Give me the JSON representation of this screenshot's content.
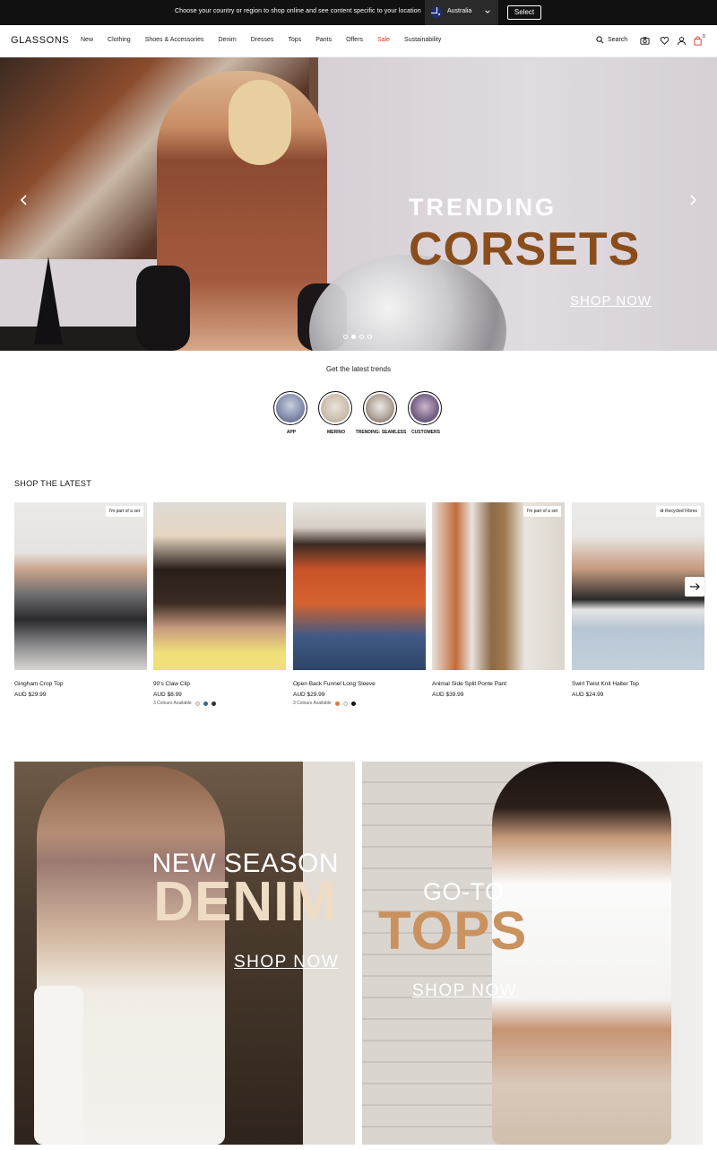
{
  "region_bar": {
    "message": "Choose your country or region to shop online and see content specific to your location",
    "country": "Australia",
    "select_label": "Select"
  },
  "header": {
    "logo": "GLASSONS",
    "nav": [
      "New",
      "Clothing",
      "Shoes & Accessories",
      "Denim",
      "Dresses",
      "Tops",
      "Pants",
      "Offers",
      "Sale",
      "Sustainability"
    ],
    "search_label": "Search",
    "cart_count": "0",
    "sale_color": "#d8342c"
  },
  "hero": {
    "line1": "TRENDING",
    "line2": "CORSETS",
    "cta": "SHOP NOW",
    "accent_color": "#8a4e1d",
    "slide_count": 4,
    "active_slide": 2
  },
  "trends": {
    "title": "Get the latest trends",
    "items": [
      {
        "label": "APP"
      },
      {
        "label": "MERINO"
      },
      {
        "label": "TRENDING: SEAMLESS"
      },
      {
        "label": "CUSTOMERS"
      }
    ]
  },
  "latest": {
    "title": "SHOP THE LATEST",
    "products": [
      {
        "name": "Gingham Crop Top",
        "price": "AUD $29.99",
        "tag": "I'm part of a set",
        "colours": "",
        "swatches": []
      },
      {
        "name": "90's Claw Clip",
        "price": "AUD $8.99",
        "tag": "",
        "colours": "3 Colours Available",
        "swatches": [
          "#e8e4dd",
          "#2f6a8e",
          "#3b2e2b"
        ]
      },
      {
        "name": "Open Back Funnel Long Sleeve",
        "price": "AUD $29.99",
        "tag": "",
        "colours": "3 Colours Available",
        "swatches": [
          "#e07a3a",
          "#f2efe9",
          "#111111"
        ]
      },
      {
        "name": "Animal Side Split Ponte Pant",
        "price": "AUD $39.99",
        "tag": "I'm part of a set",
        "colours": "",
        "swatches": []
      },
      {
        "name": "Swirl Twist Knit Halter Top",
        "price": "AUD $24.99",
        "tag": "Recycled Fibres",
        "colours": "",
        "swatches": []
      }
    ]
  },
  "promos": {
    "denim": {
      "line1": "NEW SEASON",
      "line2": "DENIM",
      "cta": "SHOP NOW"
    },
    "tops": {
      "line1": "GO-TO",
      "line2": "TOPS",
      "cta": "SHOP NOW"
    }
  }
}
